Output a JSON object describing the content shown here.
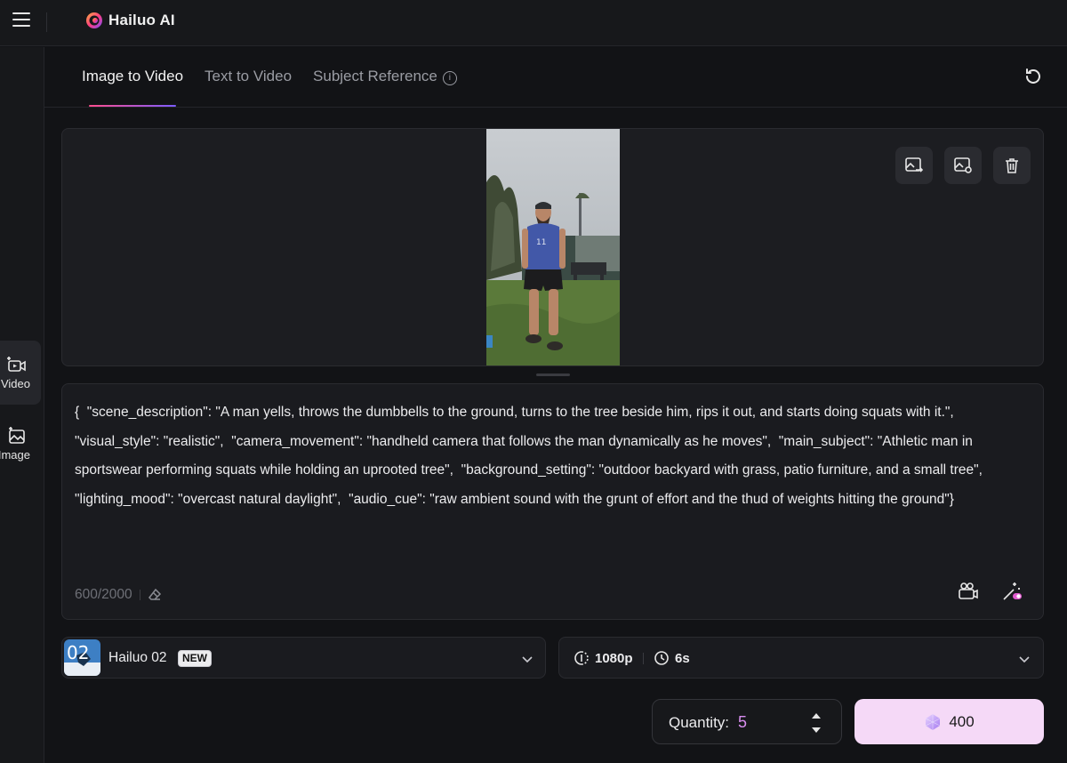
{
  "app": {
    "brand": "Hailuo AI"
  },
  "rail": [
    {
      "label": "Video",
      "icon": "video-sparkle-icon",
      "active": true
    },
    {
      "label": "Image",
      "icon": "image-sparkle-icon",
      "active": false
    }
  ],
  "tabs": [
    {
      "label": "Image to Video",
      "active": true
    },
    {
      "label": "Text to Video",
      "active": false
    },
    {
      "label": "Subject Reference",
      "active": false,
      "info_icon": "info-icon"
    }
  ],
  "image_panel": {
    "buttons": [
      "replace-image-icon",
      "image-settings-icon",
      "trash-icon"
    ]
  },
  "prompt": {
    "text": "{  \"scene_description\": \"A man yells, throws the dumbbells to the ground, turns to the tree beside him, rips it out, and starts doing squats with it.\",  \"visual_style\": \"realistic\",  \"camera_movement\": \"handheld camera that follows the man dynamically as he moves\",  \"main_subject\": \"Athletic man in sportswear performing squats while holding an uprooted tree\",  \"background_setting\": \"outdoor backyard with grass, patio furniture, and a small tree\",  \"lighting_mood\": \"overcast natural daylight\",  \"audio_cue\": \"raw ambient sound with the grunt of effort and the thud of weights hitting the ground\"}",
    "char_count": "600/2000"
  },
  "model": {
    "name": "Hailuo 02",
    "badge": "NEW",
    "thumb_text": "02"
  },
  "settings": {
    "resolution": "1080p",
    "duration": "6s"
  },
  "quantity": {
    "label": "Quantity:",
    "value": "5"
  },
  "generate": {
    "credits": "400"
  },
  "colors": {
    "accent_pink": "#d98ef0",
    "generate_bg": "#f5d9f7",
    "bg": "#121316"
  }
}
